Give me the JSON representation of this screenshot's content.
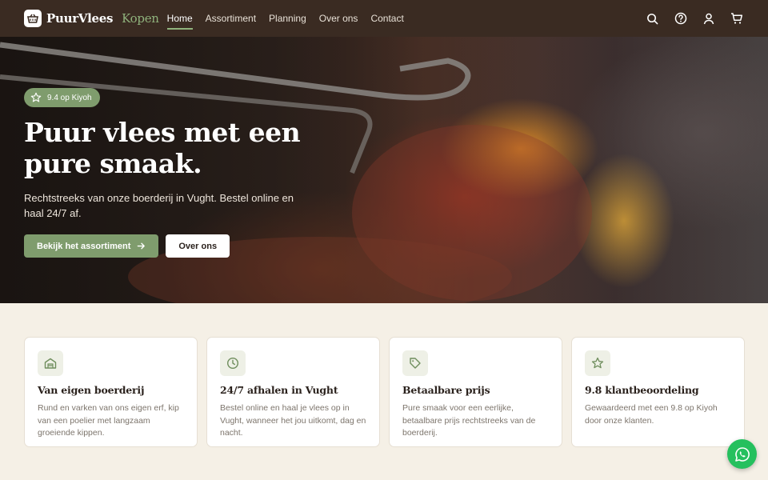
{
  "header": {
    "logo_name": "PuurVlees",
    "logo_accent": "Kopen",
    "nav": [
      {
        "label": "Home",
        "active": true
      },
      {
        "label": "Assortiment"
      },
      {
        "label": "Planning"
      },
      {
        "label": "Over ons"
      },
      {
        "label": "Contact"
      }
    ],
    "icons": [
      "search-icon",
      "help-icon",
      "user-icon",
      "cart-icon"
    ]
  },
  "hero": {
    "badge": "9.4 op Kiyoh",
    "title": "Puur vlees met een pure smaak.",
    "subtitle": "Rechtstreeks van onze boerderij in Vught. Bestel online en haal 24/7 af.",
    "primary_button": "Bekijk het assortiment",
    "secondary_button": "Over ons"
  },
  "features": [
    {
      "icon": "farm-icon",
      "title": "Van eigen boerderij",
      "text": "Rund en varken van ons eigen erf, kip van een poelier met langzaam groeiende kippen."
    },
    {
      "icon": "clock-icon",
      "title": "24/7 afhalen in Vught",
      "text": "Bestel online en haal je vlees op in Vught, wanneer het jou uitkomt, dag en nacht."
    },
    {
      "icon": "tag-icon",
      "title": "Betaalbare prijs",
      "text": "Pure smaak voor een eerlijke, betaalbare prijs rechtstreeks van de boerderij."
    },
    {
      "icon": "star-icon",
      "title": "9.8 klantbeoordeling",
      "text": "Gewaardeerd met een 9.8 op Kiyoh door onze klanten."
    }
  ],
  "colors": {
    "header": "#3a2b22",
    "accent": "#7f9c6d",
    "background": "#f5f0e6",
    "whatsapp": "#25c05e"
  }
}
